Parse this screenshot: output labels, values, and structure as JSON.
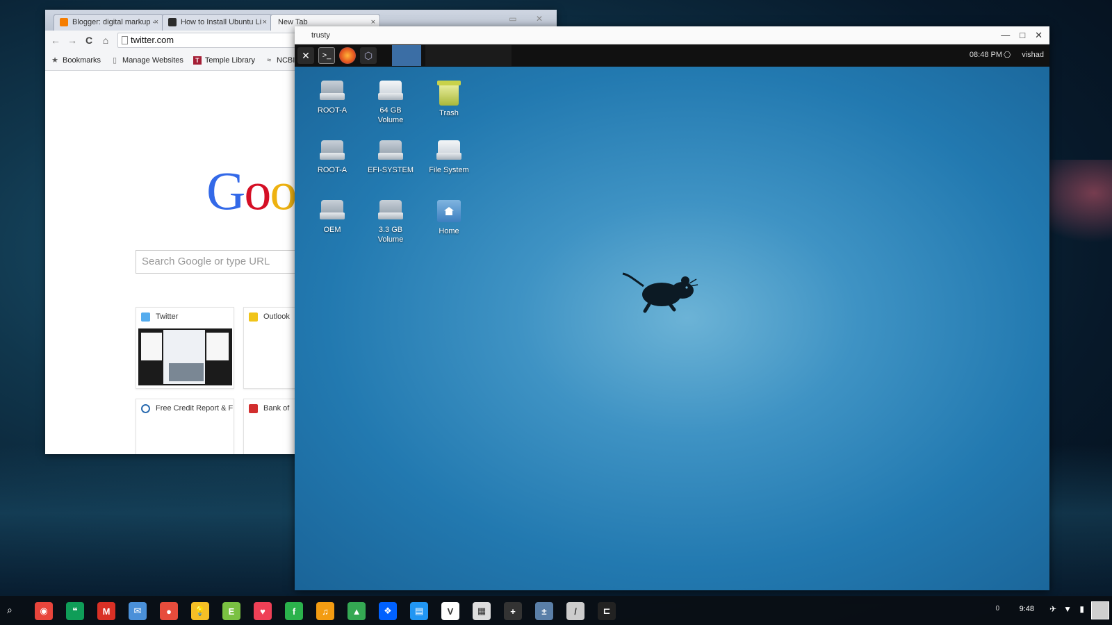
{
  "chrome": {
    "tabs": [
      {
        "label": "Blogger: digital markup -",
        "fav_color": "#f57d00"
      },
      {
        "label": "How to Install Ubuntu Li",
        "fav_color": "#2c2c2c"
      },
      {
        "label": "New Tab",
        "fav_color": ""
      }
    ],
    "tab_close": "×",
    "window_controls": "▭ ✕",
    "nav": {
      "back": "←",
      "forward": "→",
      "reload": "C",
      "home": "⌂"
    },
    "omnibox_value": "twitter.com",
    "bookmarks": [
      {
        "label": "Bookmarks",
        "icon": "★"
      },
      {
        "label": "Manage Websites",
        "icon": "▯"
      },
      {
        "label": "Temple Library",
        "icon": "T"
      },
      {
        "label": "NCBI",
        "icon": "≈"
      }
    ],
    "logo": {
      "g": "G",
      "o1": "o",
      "o2": "o"
    },
    "search_placeholder": "Search Google or type URL",
    "tiles": [
      {
        "label": "Twitter",
        "icon_color": "#55acee"
      },
      {
        "label": "Outlook",
        "icon_color": "#f0c419"
      },
      {
        "label": "Free Credit Report & F",
        "icon_color": "#2b6cb0"
      },
      {
        "label": "Bank of",
        "icon_color": "#d22e2e"
      }
    ]
  },
  "xfce": {
    "title": "trusty",
    "controls": {
      "minimize": "—",
      "maximize": "□",
      "close": "✕"
    },
    "clock": "08:48 PM",
    "user": "vishad",
    "icons": [
      {
        "label": "ROOT-A",
        "type": "drive"
      },
      {
        "label": "64 GB Volume",
        "type": "drive-light"
      },
      {
        "label": "Trash",
        "type": "trash"
      },
      {
        "label": "ROOT-A",
        "type": "drive"
      },
      {
        "label": "EFI-SYSTEM",
        "type": "drive"
      },
      {
        "label": "File System",
        "type": "drive-light"
      },
      {
        "label": "OEM",
        "type": "drive"
      },
      {
        "label": "3.3 GB Volume",
        "type": "drive"
      },
      {
        "label": "Home",
        "type": "home"
      }
    ]
  },
  "shelf": {
    "search_icon": "⌕",
    "apps": [
      {
        "name": "chrome-icon",
        "color": "#e8453c",
        "glyph": "◉"
      },
      {
        "name": "hangouts-icon",
        "color": "#0f9d58",
        "glyph": "❝"
      },
      {
        "name": "gmail-icon",
        "color": "#d93025",
        "glyph": "M"
      },
      {
        "name": "inbox-icon",
        "color": "#4a90d9",
        "glyph": "✉"
      },
      {
        "name": "red-circle-icon",
        "color": "#e74c3c",
        "glyph": "●"
      },
      {
        "name": "keep-icon",
        "color": "#f6bf26",
        "glyph": "💡"
      },
      {
        "name": "evernote-icon",
        "color": "#7ac142",
        "glyph": "E"
      },
      {
        "name": "pocket-icon",
        "color": "#ef4056",
        "glyph": "♥"
      },
      {
        "name": "feedly-icon",
        "color": "#2bb24c",
        "glyph": "f"
      },
      {
        "name": "music-icon",
        "color": "#f39c12",
        "glyph": "♫"
      },
      {
        "name": "drive-icon",
        "color": "#34a853",
        "glyph": "▲"
      },
      {
        "name": "dropbox-icon",
        "color": "#0061ff",
        "glyph": "❖"
      },
      {
        "name": "files-icon",
        "color": "#2196f3",
        "glyph": "▤"
      },
      {
        "name": "vnc-icon",
        "color": "#ffffff",
        "glyph": "V"
      },
      {
        "name": "photos-icon",
        "color": "#dddddd",
        "glyph": "▦"
      },
      {
        "name": "plus-icon",
        "color": "#333333",
        "glyph": "+"
      },
      {
        "name": "calculator-icon",
        "color": "#5a7fa8",
        "glyph": "±"
      },
      {
        "name": "brush-icon",
        "color": "#cccccc",
        "glyph": "/"
      },
      {
        "name": "crosh-icon",
        "color": "#222222",
        "glyph": "⊏"
      }
    ],
    "notification_count": "0",
    "time": "9:48"
  }
}
